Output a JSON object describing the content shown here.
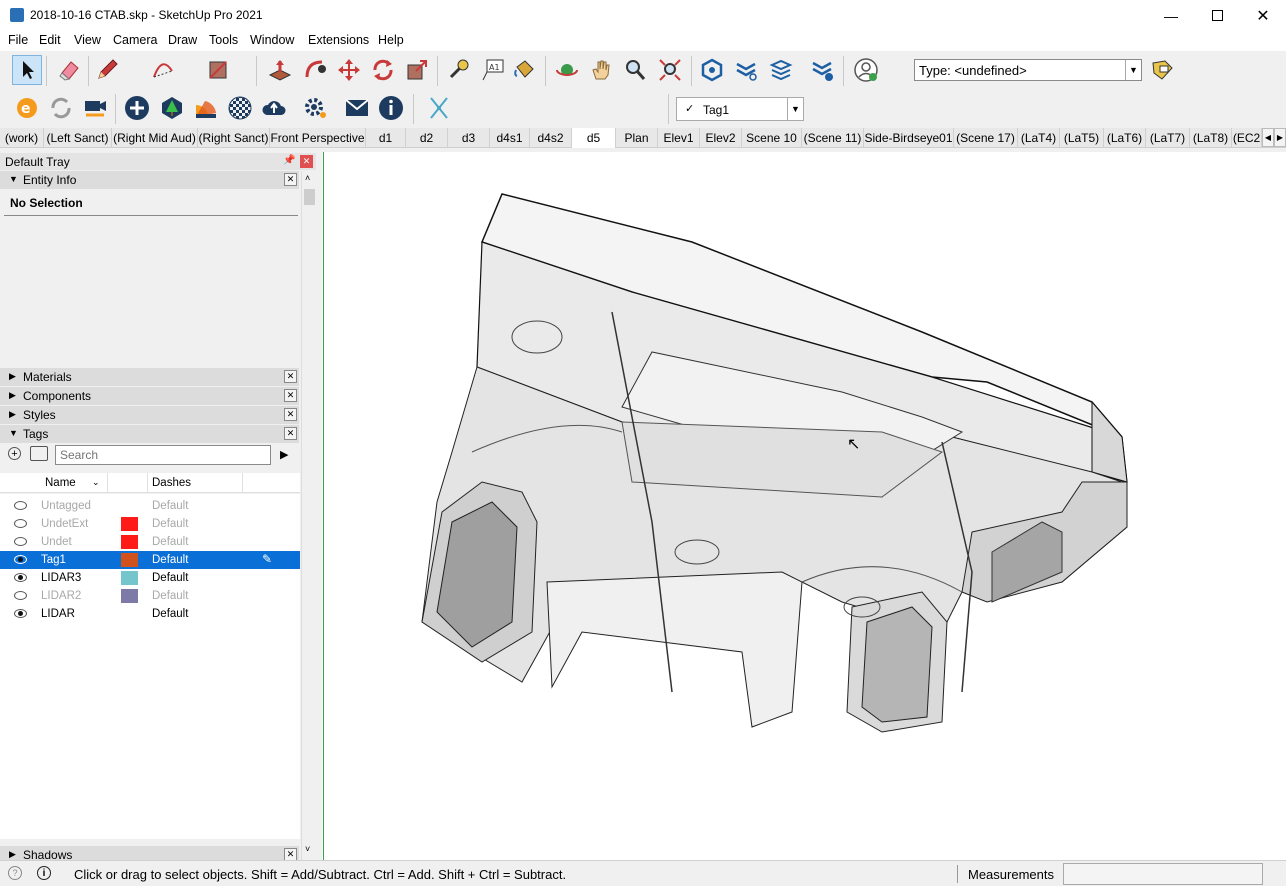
{
  "window": {
    "title": "2018-10-16 CTAB.skp - SketchUp Pro 2021",
    "min_icon": "minimize-icon",
    "max_icon": "maximize-icon",
    "close_icon": "close-icon"
  },
  "menu": [
    "File",
    "Edit",
    "View",
    "Camera",
    "Draw",
    "Tools",
    "Window",
    "Extensions",
    "Help"
  ],
  "toolbar": {
    "type_selector": "Type: <undefined>",
    "tag_selector": "Tag1"
  },
  "scenes": [
    "(work)",
    "(Left Sanct)",
    "(Right Mid Aud)",
    "(Right Sanct)",
    "Front Perspective",
    "d1",
    "d2",
    "d3",
    "d4s1",
    "d4s2",
    "d5",
    "Plan",
    "Elev1",
    "Elev2",
    "Scene 10",
    "(Scene 11)",
    "Side-Birdseye01",
    "(Scene 17)",
    "(LaT4)",
    "(LaT5)",
    "(LaT6)",
    "(LaT7)",
    "(LaT8)",
    "(EC2"
  ],
  "active_scene": "d5",
  "tray": {
    "title": "Default Tray",
    "entity_info": {
      "header": "Entity Info",
      "selection": "No Selection"
    },
    "panels": {
      "materials": "Materials",
      "components": "Components",
      "styles": "Styles",
      "tags": "Tags",
      "shadows": "Shadows"
    },
    "tags_panel": {
      "search_placeholder": "Search",
      "col_name": "Name",
      "col_dashes": "Dashes",
      "rows": [
        {
          "name": "Untagged",
          "color": "",
          "dashes": "Default",
          "visible": false,
          "dimmed": true,
          "selected": false
        },
        {
          "name": "UndetExt",
          "color": "#ff1a1a",
          "dashes": "Default",
          "visible": false,
          "dimmed": true,
          "selected": false
        },
        {
          "name": "Undet",
          "color": "#ff1a1a",
          "dashes": "Default",
          "visible": false,
          "dimmed": true,
          "selected": false
        },
        {
          "name": "Tag1",
          "color": "#d2521e",
          "dashes": "Default",
          "visible": true,
          "dimmed": false,
          "selected": true
        },
        {
          "name": "LIDAR3",
          "color": "#74c6cc",
          "dashes": "Default",
          "visible": true,
          "dimmed": false,
          "selected": false
        },
        {
          "name": "LIDAR2",
          "color": "#7e7aa8",
          "dashes": "Default",
          "visible": false,
          "dimmed": true,
          "selected": false
        },
        {
          "name": "LIDAR",
          "color": "",
          "dashes": "Default",
          "visible": true,
          "dimmed": false,
          "selected": false
        }
      ]
    }
  },
  "status": {
    "hint": "Click or drag to select objects. Shift = Add/Subtract. Ctrl = Add. Shift + Ctrl = Subtract.",
    "measurements_label": "Measurements",
    "measurements_value": ""
  }
}
